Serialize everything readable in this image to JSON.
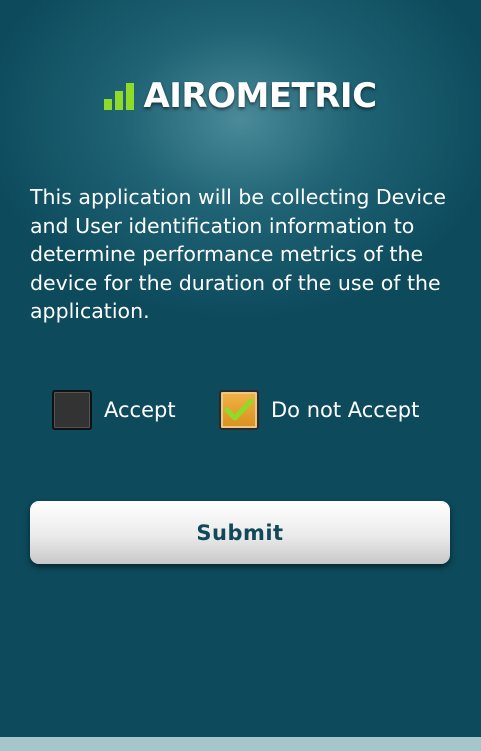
{
  "brand": {
    "name": "AIROMETRIC",
    "logo_icon": "signal-bars-icon",
    "accent_color": "#8edc29"
  },
  "message": "This application will be collecting Device and User identification information to determine performance metrics of the device for the duration of the use of the application.",
  "options": [
    {
      "label": "Accept",
      "checked": false
    },
    {
      "label": "Do not Accept",
      "checked": true
    }
  ],
  "submit": {
    "label": "Submit"
  },
  "colors": {
    "background": "#0c4a5c",
    "checkbox_checked": "#e8a534",
    "checkmark": "#8edc29",
    "button_text": "#12495a"
  }
}
